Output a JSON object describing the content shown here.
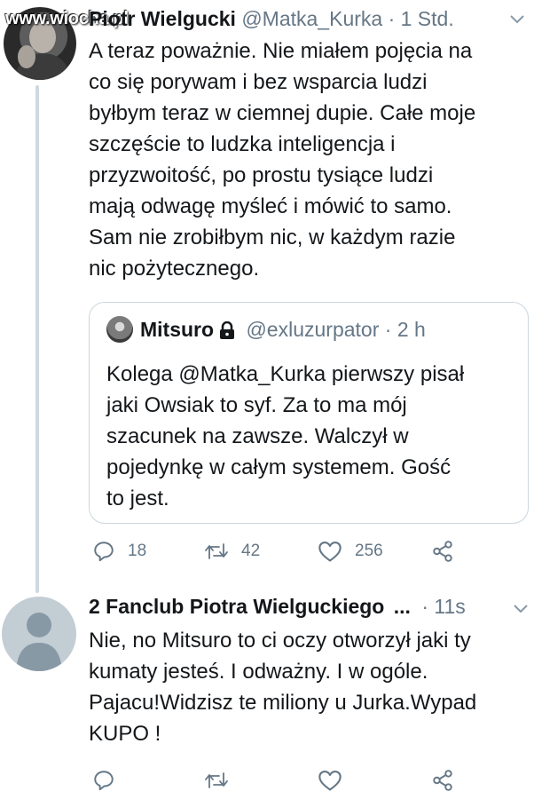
{
  "watermark": "www.wiocha.pl",
  "tweet1": {
    "author_name": "Piotr Wielgucki",
    "handle": "@Matka_Kurka",
    "time": "· 1 Std.",
    "lines": [
      "A teraz poważnie. Nie miałem pojęcia na",
      "co się porywam i bez wsparcia ludzi",
      "byłbym teraz w ciemnej dupie. Całe moje",
      "szczęście to ludzka inteligencja i",
      "przyzwoitość, po prostu tysiące ludzi",
      "mają odwagę myśleć i mówić to samo.",
      "Sam nie zrobiłbym nic, w każdym razie",
      "nic pożytecznego."
    ],
    "quote": {
      "author_name": "Mitsuro",
      "handle": "@exluzurpator",
      "time": "· 2 h",
      "lines": [
        "Kolega @Matka_Kurka pierwszy pisał",
        "jaki Owsiak to syf. Za to ma mój",
        "szacunek na zawsze. Walczył w",
        "pojedynkę w całym systemem. Gość",
        "to jest."
      ]
    },
    "actions": {
      "replies": "18",
      "retweets": "42",
      "likes": "256"
    }
  },
  "tweet2": {
    "author_name": "2 Fanclub Piotra Wielguckiego",
    "ellipsis": "...",
    "time": "· 11s",
    "lines": [
      "Nie, no Mitsuro to ci oczy otworzył jaki ty",
      "kumaty jesteś. I odważny. I w ogóle.",
      "Pajacu!Widzisz te miliony u Jurka.Wypad",
      "KUPO !"
    ]
  },
  "icons": {
    "reply": "reply-icon",
    "retweet": "retweet-icon",
    "like": "heart-icon",
    "share": "share-icon",
    "menu": "chevron-down-icon",
    "lock": "lock-icon"
  },
  "colors": {
    "text": "#14171a",
    "secondary": "#657786",
    "border": "#ccd6dd",
    "thread": "#cfd9de"
  }
}
